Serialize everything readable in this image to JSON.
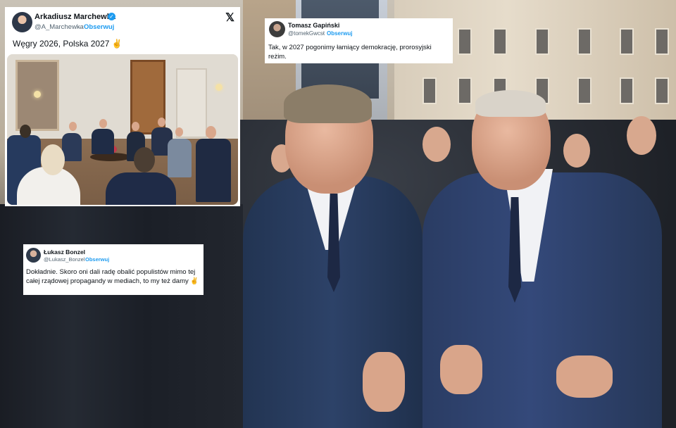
{
  "colors": {
    "link": "#1d9bf0",
    "verified": "#1d9bf0",
    "text": "#0f1419",
    "muted": "#536471",
    "card": "#ffffff"
  },
  "tweets": [
    {
      "name": "Arkadiusz Marchewka",
      "handle": "@A_Marchewka",
      "separator": "·",
      "follow": "Obserwuj",
      "text": "Węgry 2026, Polska 2027 ✌",
      "verified_icon": "check-icon",
      "platform_icon": "x-logo-icon",
      "platform_glyph": "𝕏"
    },
    {
      "name": "Tomasz Gapiński",
      "handle": "@tomekGwcst",
      "separator": "·",
      "follow": "Obserwuj",
      "text": "Tak, w 2027 pogonimy łamiący demokrację, prorosyjski reżim."
    },
    {
      "name": "Łukasz Bonzel",
      "handle": "@Lukasz_Bonzel",
      "separator": "·",
      "follow": "Obserwuj",
      "text": "Dokładnie. Skoro oni dali radę obalić populistów mimo tej całej rządowej propagandy w mediach, to my też damy ✌"
    }
  ]
}
